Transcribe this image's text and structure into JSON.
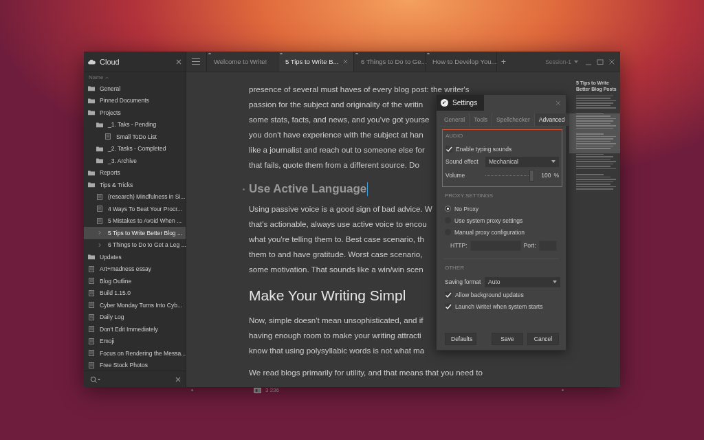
{
  "sidebar": {
    "title": "Cloud",
    "sort_label": "Name",
    "items": [
      {
        "kind": "folder",
        "label": "General",
        "selected": false
      },
      {
        "kind": "folder",
        "label": "Pinned Documents",
        "selected": false
      },
      {
        "kind": "folder",
        "label": "Projects",
        "selected": false,
        "children": [
          {
            "kind": "folder",
            "label": "_1. Taks - Pending",
            "selected": false,
            "children": [
              {
                "kind": "document",
                "label": "Small ToDo List",
                "selected": false
              }
            ]
          },
          {
            "kind": "folder",
            "label": "_2. Tasks - Completed",
            "selected": false
          },
          {
            "kind": "folder",
            "label": "_3. Archive",
            "selected": false
          }
        ]
      },
      {
        "kind": "folder",
        "label": "Reports",
        "selected": false
      },
      {
        "kind": "folder",
        "label": "Tips & Tricks",
        "selected": false,
        "children": [
          {
            "kind": "document",
            "label": "(research) Mindfulness in Si...",
            "selected": false
          },
          {
            "kind": "document",
            "label": "4 Ways To Beat Your Procr...",
            "selected": false
          },
          {
            "kind": "document",
            "label": "5 Mistakes to Avoid When ...",
            "selected": false
          },
          {
            "kind": "outline",
            "label": "5 Tips to Write Better Blog ...",
            "selected": true,
            "expanded": false
          },
          {
            "kind": "outline",
            "label": "6 Things to Do to Get a Leg ...",
            "selected": false,
            "expanded": false
          }
        ]
      },
      {
        "kind": "folder",
        "label": "Updates",
        "selected": false
      },
      {
        "kind": "document",
        "label": "Art+madness essay",
        "selected": false
      },
      {
        "kind": "document",
        "label": "Blog Outline",
        "selected": false
      },
      {
        "kind": "document",
        "label": "Build 1.15.0",
        "selected": false
      },
      {
        "kind": "document",
        "label": "Cyber Monday Turns Into Cyb...",
        "selected": false
      },
      {
        "kind": "document",
        "label": "Daily Log",
        "selected": false
      },
      {
        "kind": "document",
        "label": "Don't Edit Immediately",
        "selected": false
      },
      {
        "kind": "document",
        "label": "Emoji",
        "selected": false
      },
      {
        "kind": "document",
        "label": "Focus on Rendering the Messa...",
        "selected": false
      },
      {
        "kind": "document",
        "label": "Free Stock Photos",
        "selected": false
      }
    ]
  },
  "tabs": [
    {
      "label": "Welcome to Write!",
      "selected": false
    },
    {
      "label": "5 Tips to Write B...",
      "selected": true
    },
    {
      "label": "6 Things to Do to Ge...",
      "selected": false
    },
    {
      "label": "How to Develop You...",
      "selected": false
    }
  ],
  "new_tab": "+",
  "session": "Session-1",
  "editor": {
    "blocks": [
      {
        "kind": "paragraph",
        "lines": [
          "presence of several must haves of every blog post: the writer's",
          "passion for the subject and originality of the writin",
          "some stats, facts, and news, and you've got yourse",
          "you don't have experience with the subject at han",
          "like a journalist and reach out to someone else for",
          "that fails, quote them from a different source. Do"
        ]
      },
      {
        "kind": "subheading",
        "text": "Use Active Language",
        "cursor": true
      },
      {
        "kind": "paragraph",
        "lines": [
          "Using passive voice is a good sign of bad advice. W",
          "that's actionable, always use active voice to encou",
          "what you're telling them to. Best case scenario, th",
          "them to and have gratitude. Worst case scenario,",
          "some motivation. That sounds like a win/win scen"
        ]
      },
      {
        "kind": "heading",
        "text": "Make Your Writing Simpl"
      },
      {
        "kind": "paragraph",
        "lines": [
          "Now, simple doesn't mean unsophisticated, and if",
          "having enough room to make your writing attracti",
          "know that using polysyllabic words is not what ma"
        ]
      },
      {
        "kind": "paragraph",
        "lines": [
          "We read blogs primarily for utility, and that means that you need to"
        ]
      }
    ],
    "word_count": "3 236"
  },
  "minimap": {
    "title": "5 Tips to Write Better Blog Posts"
  },
  "settings": {
    "title": "Settings",
    "tabs": [
      {
        "label": "General",
        "selected": false
      },
      {
        "label": "Tools",
        "selected": false
      },
      {
        "label": "Spellchecker",
        "selected": false
      },
      {
        "label": "Advanced",
        "selected": true
      }
    ],
    "audio": {
      "heading": "AUDIO",
      "highlighted": true,
      "typing_sounds": {
        "label": "Enable typing sounds",
        "checked": true
      },
      "sound_effect": {
        "label": "Sound effect",
        "value": "Mechanical"
      },
      "volume": {
        "label": "Volume",
        "level": 1,
        "reading": "100",
        "unit": "%"
      }
    },
    "proxy": {
      "heading": "PROXY SETTINGS",
      "options": [
        {
          "label": "No Proxy",
          "selected": true
        },
        {
          "label": "Use system proxy settings",
          "selected": false
        },
        {
          "label": "Manual proxy configuration",
          "selected": false
        }
      ],
      "http_label": "HTTP:",
      "port_label": "Port:"
    },
    "other": {
      "heading": "OTHER",
      "saving_format": {
        "label": "Saving format",
        "value": "Auto"
      },
      "checkboxes": [
        {
          "label": "Allow background updates",
          "checked": true
        },
        {
          "label": "Launch Write! when system starts",
          "checked": true
        }
      ]
    },
    "buttons": [
      "Defaults",
      "Save",
      "Cancel"
    ]
  }
}
